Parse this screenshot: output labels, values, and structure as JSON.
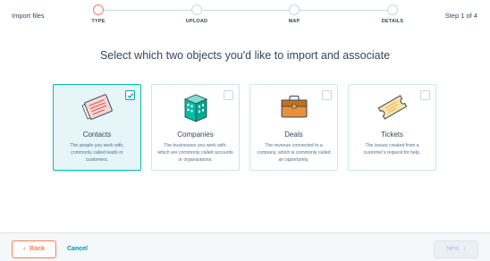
{
  "header": {
    "title": "Import files",
    "step_count": "Step 1 of 4",
    "steps": [
      {
        "label": "TYPE"
      },
      {
        "label": "UPLOAD"
      },
      {
        "label": "MAP"
      },
      {
        "label": "DETAILS"
      }
    ]
  },
  "heading": "Select which two objects you'd like to import and associate",
  "cards": [
    {
      "title": "Contacts",
      "description": "The people you work with, commonly called leads or customers.",
      "icon": "contacts-icon",
      "checked": true
    },
    {
      "title": "Companies",
      "description": "The businesses you work with, which are commonly called accounts or organizations.",
      "icon": "companies-icon",
      "checked": false
    },
    {
      "title": "Deals",
      "description": "The revenue connected to a company, which is commonly called an opportunity.",
      "icon": "deals-icon",
      "checked": false
    },
    {
      "title": "Tickets",
      "description": "The issues created from a customer's request for help.",
      "icon": "tickets-icon",
      "checked": false
    }
  ],
  "footer": {
    "back_label": "Back",
    "cancel_label": "Cancel",
    "next_label": "Next"
  },
  "colors": {
    "accent_orange": "#ff7a59",
    "teal": "#00bda5",
    "link_blue": "#0091ae"
  }
}
